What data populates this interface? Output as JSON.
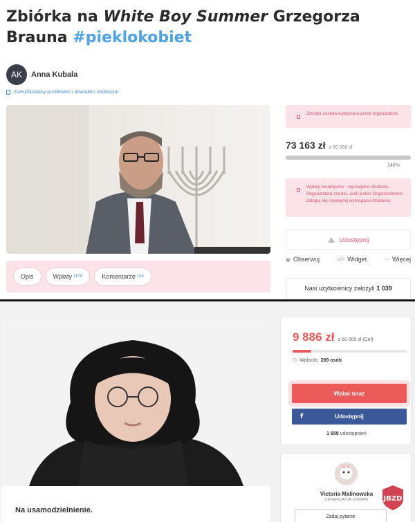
{
  "top": {
    "title_prefix": "Zbiórka na ",
    "title_italic": "White Boy Summer",
    "title_suffix": " Grzegorza Brauna ",
    "title_hashtag": "#pieklokobiet",
    "author": {
      "initials": "AK",
      "name": "Anna Kubala"
    },
    "verified_text": "Zweryfikowany przelewem i dowodem osobistym",
    "tabs": [
      {
        "label": "Opis",
        "count": ""
      },
      {
        "label": "Wpłaty",
        "count": "1870"
      },
      {
        "label": "Komentarze",
        "count": "104"
      }
    ],
    "alert_disabled": "Zrzutka została wyłączona przez organizatora",
    "amount": "73 163 zł",
    "goal": "z 50 000 zł",
    "progress_percent": "146%",
    "progress_value": 1.46,
    "alert_inactive": "Wpłaty nieaktywne - wymagane działanie Organizatora zrzutki. Jeśli jesteś Organizatorem - zaloguj się i podejmij wymagane działania.",
    "share_label": "Udostępnij",
    "actions": {
      "observe": "Obserwuj",
      "widget": "Widget",
      "more": "Więcej"
    },
    "users_text": "Nasi użytkownicy założyli",
    "users_count": "1 039"
  },
  "bottom": {
    "amount": "9 886 zł",
    "goal": "z 60 000 zł (Cel)",
    "progress_value": 0.165,
    "donors_prefix": "Wpłaciło",
    "donors_count": "289 osób",
    "donate_label": "Wpłać teraz",
    "fb_icon": "f",
    "fb_share_label": "Udostępnij",
    "shares_count": "1 659",
    "shares_label": "udostępnień",
    "organizer_name": "Victoria Malinowska",
    "organizer_role": "ORGANIZATOR ZBIÓRKI",
    "ask_label": "Zadaj pytanie",
    "description_heading": "Na usamodzielnienie."
  },
  "colors": {
    "accent_pink": "#e55a72",
    "alert_bg": "#fbe3e7",
    "donate_red": "#ec5a5a",
    "facebook_blue": "#3b5998",
    "hashtag_blue": "#4fa3e0"
  },
  "watermark": "JBZD"
}
